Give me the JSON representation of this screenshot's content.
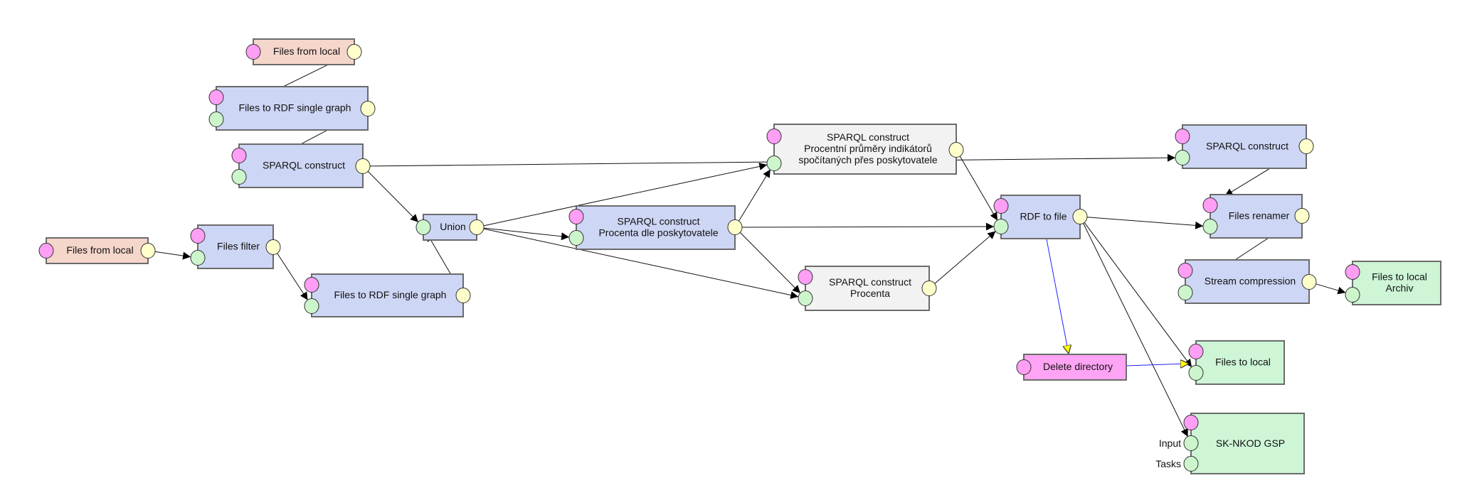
{
  "colors": {
    "component": "#cdd6f4",
    "input_source": "#f5d6cb",
    "template": "#f2f2f2",
    "output_sink": "#cdf5d6",
    "delete": "#ffa4f4",
    "port_config": "#ff9ef5",
    "port_input": "#ccf5cc",
    "port_output": "#ffffcc",
    "edge": "#111111",
    "control_edge": "#2222ff",
    "control_arrow": "#ffff00"
  },
  "nodes": [
    {
      "id": "ffl1",
      "lines": [
        "Files from local"
      ],
      "kind": "input_source"
    },
    {
      "id": "frdf1",
      "lines": [
        "Files to RDF single graph"
      ],
      "kind": "component"
    },
    {
      "id": "sc1",
      "lines": [
        "SPARQL construct"
      ],
      "kind": "component"
    },
    {
      "id": "union",
      "lines": [
        "Union"
      ],
      "kind": "component"
    },
    {
      "id": "ffl2",
      "lines": [
        "Files from local"
      ],
      "kind": "input_source"
    },
    {
      "id": "filter",
      "lines": [
        "Files filter"
      ],
      "kind": "component"
    },
    {
      "id": "frdf2",
      "lines": [
        "Files to RDF single graph"
      ],
      "kind": "component"
    },
    {
      "id": "scpp",
      "lines": [
        "SPARQL construct",
        "Procentní průměry indikátorů",
        "spočítaných přes poskytovatele"
      ],
      "kind": "template"
    },
    {
      "id": "scdle",
      "lines": [
        "SPARQL construct",
        "Procenta dle poskytovatele"
      ],
      "kind": "component"
    },
    {
      "id": "scproc",
      "lines": [
        "SPARQL construct",
        "Procenta"
      ],
      "kind": "template"
    },
    {
      "id": "sc3",
      "lines": [
        "SPARQL construct"
      ],
      "kind": "component"
    },
    {
      "id": "rdf2file",
      "lines": [
        "RDF to file"
      ],
      "kind": "component"
    },
    {
      "id": "renamer",
      "lines": [
        "Files renamer"
      ],
      "kind": "component"
    },
    {
      "id": "stream",
      "lines": [
        "Stream compression"
      ],
      "kind": "component"
    },
    {
      "id": "archiv",
      "lines": [
        "Files to local",
        "Archiv"
      ],
      "kind": "output_sink"
    },
    {
      "id": "deldir",
      "lines": [
        "Delete directory"
      ],
      "kind": "delete"
    },
    {
      "id": "ftl",
      "lines": [
        "Files to local"
      ],
      "kind": "output_sink"
    },
    {
      "id": "sknkod",
      "lines": [
        "SK-NKOD GSP"
      ],
      "kind": "output_sink",
      "port_labels": [
        "Input",
        "Tasks"
      ]
    }
  ],
  "edges": [
    {
      "from": "ffl1",
      "to": "frdf1"
    },
    {
      "from": "frdf1",
      "to": "sc1"
    },
    {
      "from": "sc1",
      "to": "union"
    },
    {
      "from": "sc1",
      "to": "sc3"
    },
    {
      "from": "ffl2",
      "to": "filter"
    },
    {
      "from": "filter",
      "to": "frdf2"
    },
    {
      "from": "frdf2",
      "to": "union"
    },
    {
      "from": "union",
      "to": "scdle"
    },
    {
      "from": "union",
      "to": "scpp"
    },
    {
      "from": "union",
      "to": "scproc"
    },
    {
      "from": "scdle",
      "to": "scpp"
    },
    {
      "from": "scdle",
      "to": "rdf2file"
    },
    {
      "from": "scdle",
      "to": "scproc"
    },
    {
      "from": "scpp",
      "to": "rdf2file"
    },
    {
      "from": "scproc",
      "to": "rdf2file"
    },
    {
      "from": "sc3",
      "to": "renamer"
    },
    {
      "from": "renamer",
      "to": "stream"
    },
    {
      "from": "stream",
      "to": "archiv"
    },
    {
      "from": "rdf2file",
      "to": "renamer"
    },
    {
      "from": "rdf2file",
      "to": "ftl"
    },
    {
      "from": "rdf2file",
      "to": "sknkod"
    },
    {
      "from": "rdf2file",
      "to": "deldir",
      "type": "control"
    },
    {
      "from": "deldir",
      "to": "ftl",
      "type": "control"
    }
  ]
}
